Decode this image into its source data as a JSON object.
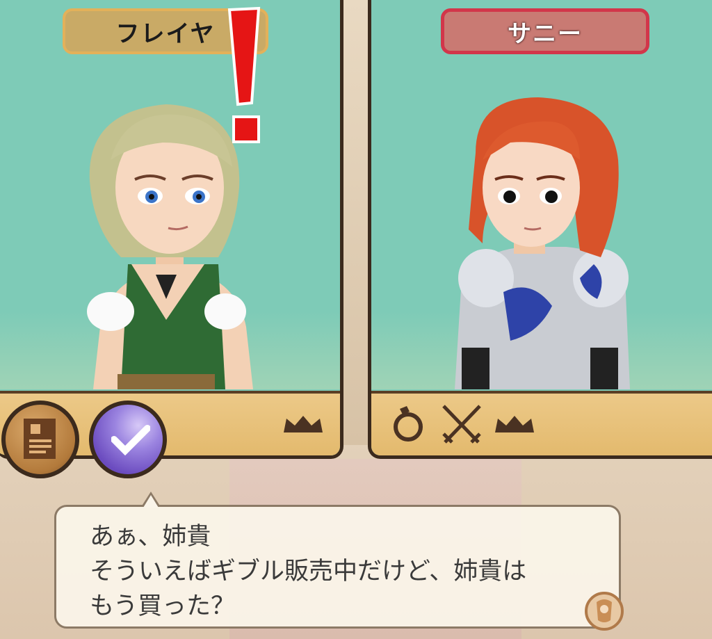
{
  "characters": {
    "left": {
      "name": "フレイヤ",
      "alert_icon": "exclamation-icon",
      "name_color": "#c9aa66"
    },
    "right": {
      "name": "サニー",
      "name_color": "#c97a73",
      "border_color": "#d2364a"
    }
  },
  "left_bar_icons": [
    "document-icon",
    "checkmark-icon",
    "crown-icon"
  ],
  "right_bar_icons": [
    "ring-icon",
    "crossed-swords-icon",
    "crown-icon"
  ],
  "dialogue": {
    "lines": [
      "あぁ、姉貴",
      "そういえばギブル販売中だけど、姉貴は",
      "もう買った？"
    ],
    "advance_icon": "scroll-icon"
  },
  "colors": {
    "panel_bg": "#7ecbb7",
    "bar_bg": "#e3b96c",
    "frame": "#3b2a1d"
  }
}
